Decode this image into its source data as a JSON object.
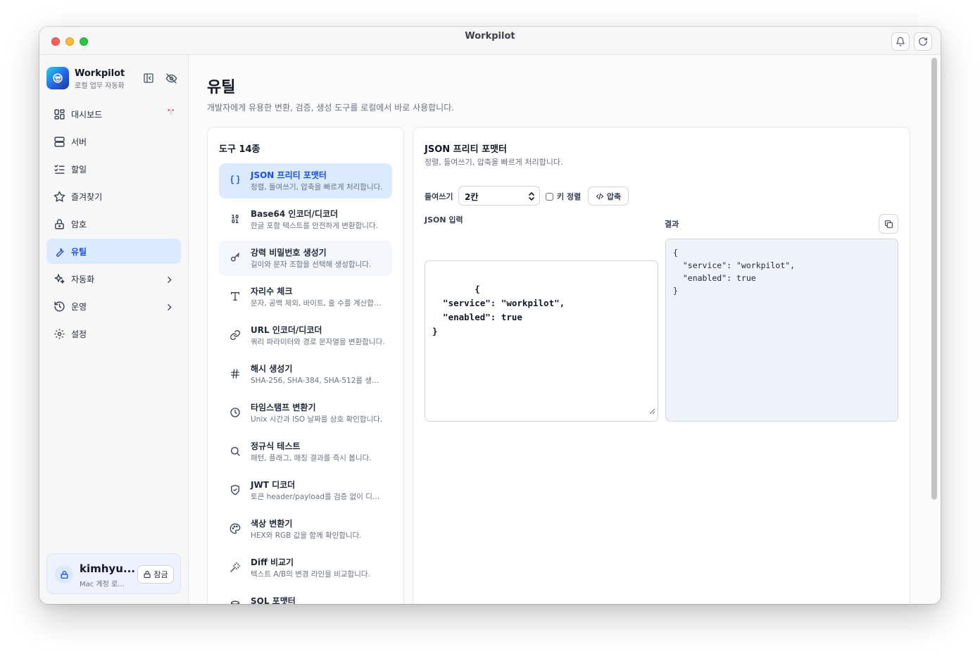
{
  "window": {
    "title": "Workpilot"
  },
  "brand": {
    "name": "Workpilot",
    "subtitle": "로컬 업무 자동화"
  },
  "nav": {
    "items": [
      {
        "label": "대시보드",
        "icon": "dashboard-icon",
        "badge": "🎌"
      },
      {
        "label": "서버",
        "icon": "server-icon"
      },
      {
        "label": "할일",
        "icon": "checklist-icon"
      },
      {
        "label": "즐겨찾기",
        "icon": "star-icon"
      },
      {
        "label": "암호",
        "icon": "lock-icon"
      },
      {
        "label": "유틸",
        "icon": "wrench-icon",
        "active": true
      },
      {
        "label": "자동화",
        "icon": "sparkles-icon",
        "expandable": true
      },
      {
        "label": "운영",
        "icon": "history-icon",
        "expandable": true
      },
      {
        "label": "설정",
        "icon": "gear-icon"
      }
    ]
  },
  "user": {
    "name": "kimhyu...",
    "subtitle": "Mac 계정 로...",
    "lock_label": "잠금"
  },
  "page": {
    "title": "유틸",
    "description": "개발자에게 유용한 변환, 검증, 생성 도구를 로컬에서 바로 사용합니다."
  },
  "tools": {
    "title": "도구 14종",
    "items": [
      {
        "name": "JSON 프리티 포맷터",
        "desc": "정렬, 들여쓰기, 압축을 빠르게 처리합니다.",
        "icon": "braces-icon",
        "active": true
      },
      {
        "name": "Base64 인코더/디코더",
        "desc": "한글 포함 텍스트를 안전하게 변환합니다.",
        "icon": "binary-icon"
      },
      {
        "name": "강력 비밀번호 생성기",
        "desc": "길이와 문자 조합을 선택해 생성합니다.",
        "icon": "key-icon",
        "hover": true
      },
      {
        "name": "자리수 체크",
        "desc": "문자, 공백 제외, 바이트, 줄 수를 계산합니다.",
        "icon": "type-icon"
      },
      {
        "name": "URL 인코더/디코더",
        "desc": "쿼리 파라미터와 경로 문자열을 변환합니다.",
        "icon": "link-icon"
      },
      {
        "name": "해시 생성기",
        "desc": "SHA-256, SHA-384, SHA-512를 생성합니다.",
        "icon": "hash-icon"
      },
      {
        "name": "타임스탬프 변환기",
        "desc": "Unix 시간과 ISO 날짜를 상호 확인합니다.",
        "icon": "clock-icon"
      },
      {
        "name": "정규식 테스트",
        "desc": "패턴, 플래그, 매칭 결과를 즉시 봅니다.",
        "icon": "search-icon"
      },
      {
        "name": "JWT 디코더",
        "desc": "토큰 header/payload를 검증 없이 디코딩합니다.",
        "icon": "shield-check-icon"
      },
      {
        "name": "색상 변환기",
        "desc": "HEX와 RGB 값을 함께 확인합니다.",
        "icon": "palette-icon"
      },
      {
        "name": "Diff 비교기",
        "desc": "텍스트 A/B의 변경 라인을 비교합니다.",
        "icon": "wand-icon"
      },
      {
        "name": "SQL 포맷터",
        "desc": "",
        "icon": "database-icon"
      }
    ]
  },
  "detail": {
    "title": "JSON 프리티 포맷터",
    "description": "정렬, 들여쓰기, 압축을 빠르게 처리합니다.",
    "indent_label": "들여쓰기",
    "indent_value": "2칸",
    "sort_keys_label": "키 정렬",
    "compress_label": "압축",
    "input_label": "JSON 입력",
    "result_label": "결과",
    "input_value": "{\n  \"service\": \"workpilot\",\n  \"enabled\": true\n}",
    "output_value": "{\n  \"service\": \"workpilot\",\n  \"enabled\": true\n}"
  },
  "colors": {
    "accent": "#2563eb",
    "active_bg": "#dbeafe",
    "badge": "#ea580c"
  }
}
